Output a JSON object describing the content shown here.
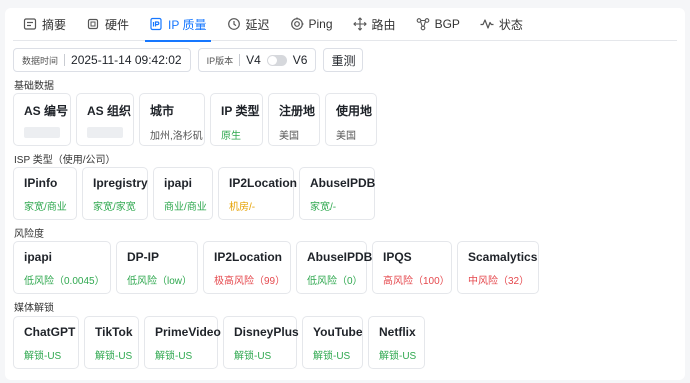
{
  "tabs": [
    {
      "label": "摘要",
      "icon": "summary-icon"
    },
    {
      "label": "硬件",
      "icon": "chip-icon"
    },
    {
      "label": "IP 质量",
      "icon": "ip-quality-icon"
    },
    {
      "label": "延迟",
      "icon": "clock-icon"
    },
    {
      "label": "Ping",
      "icon": "ping-icon"
    },
    {
      "label": "路由",
      "icon": "route-icon"
    },
    {
      "label": "BGP",
      "icon": "bgp-icon"
    },
    {
      "label": "状态",
      "icon": "pulse-icon"
    }
  ],
  "active_tab": "IP 质量",
  "toolbar": {
    "time_label": "数据时间",
    "time_value": "2025-11-14 09:42:02",
    "version_label": "IP版本",
    "v4": "V4",
    "v6": "V6",
    "retest": "重测"
  },
  "sections": {
    "basic": "基础数据",
    "isp": "ISP 类型（使用/公司）",
    "risk": "风险度",
    "media": "媒体解锁"
  },
  "basic_cards": [
    {
      "title": "AS 编号",
      "value": "",
      "color": "gray"
    },
    {
      "title": "AS 组织",
      "value": "",
      "color": "gray"
    },
    {
      "title": "城市",
      "value": "加州,洛杉矶",
      "color": "gray"
    },
    {
      "title": "IP 类型",
      "value": "原生",
      "color": "green"
    },
    {
      "title": "注册地",
      "value": "美国",
      "color": "gray"
    },
    {
      "title": "使用地",
      "value": "美国",
      "color": "gray"
    }
  ],
  "isp_cards": [
    {
      "title": "IPinfo",
      "value": "家宽/商业",
      "color": "green"
    },
    {
      "title": "Ipregistry",
      "value": "家宽/家宽",
      "color": "green"
    },
    {
      "title": "ipapi",
      "value": "商业/商业",
      "color": "green"
    },
    {
      "title": "IP2Location",
      "value": "机房/-",
      "color": "orange"
    },
    {
      "title": "AbuseIPDB",
      "value": "家宽/-",
      "color": "green"
    }
  ],
  "risk_cards": [
    {
      "title": "ipapi",
      "value": "低风险（0.0045）",
      "color": "green"
    },
    {
      "title": "DP-IP",
      "value": "低风险（low）",
      "color": "green"
    },
    {
      "title": "IP2Location",
      "value": "极高风险（99）",
      "color": "red"
    },
    {
      "title": "AbuseIPDB",
      "value": "低风险（0）",
      "color": "green"
    },
    {
      "title": "IPQS",
      "value": "高风险（100）",
      "color": "red"
    },
    {
      "title": "Scamalytics",
      "value": "中风险（32）",
      "color": "red"
    }
  ],
  "media_cards": [
    {
      "title": "ChatGPT",
      "value": "解锁-US",
      "color": "green"
    },
    {
      "title": "TikTok",
      "value": "解锁-US",
      "color": "green"
    },
    {
      "title": "PrimeVideo",
      "value": "解锁-US",
      "color": "green"
    },
    {
      "title": "DisneyPlus",
      "value": "解锁-US",
      "color": "green"
    },
    {
      "title": "YouTube",
      "value": "解锁-US",
      "color": "green"
    },
    {
      "title": "Netflix",
      "value": "解锁-US",
      "color": "green"
    }
  ],
  "colors": {
    "accent": "#1677ff",
    "green": "#2fa84f",
    "orange": "#e6a100",
    "red": "#e5484d"
  }
}
